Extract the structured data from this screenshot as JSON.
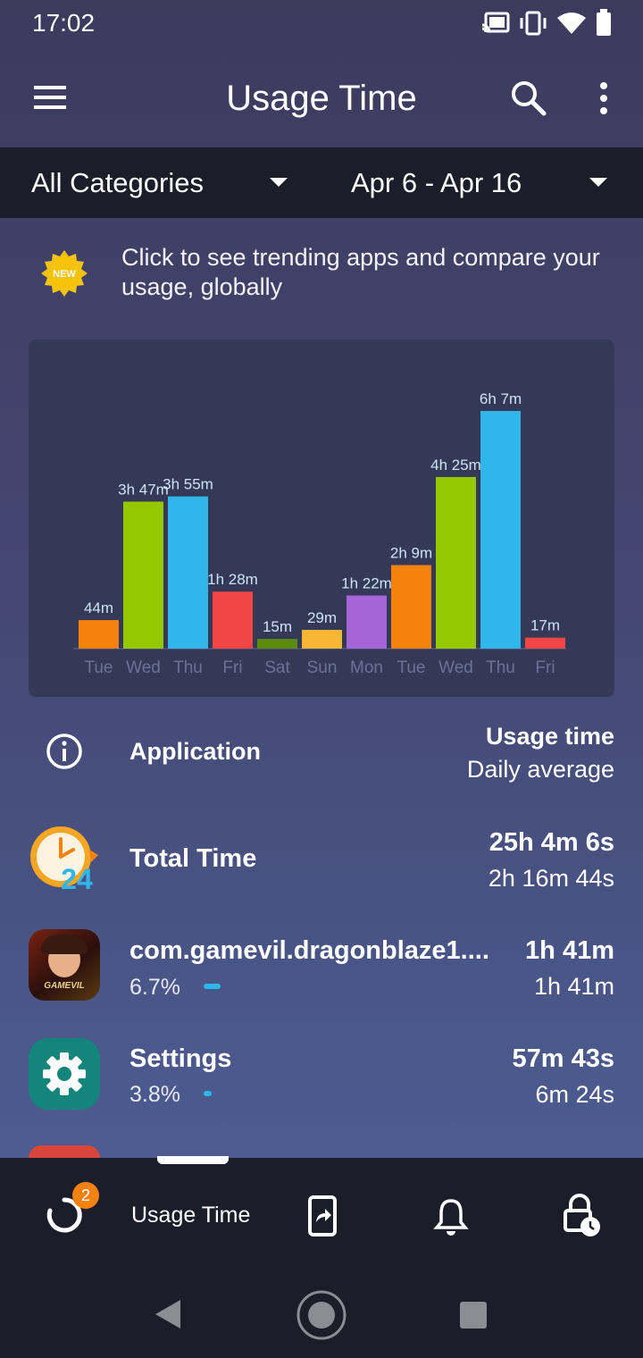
{
  "status": {
    "time": "17:02"
  },
  "header": {
    "title": "Usage Time"
  },
  "filters": {
    "category": "All Categories",
    "date_range": "Apr 6 - Apr 16"
  },
  "promo": {
    "badge": "NEW",
    "text": "Click to see trending apps and compare your usage, globally"
  },
  "chart_data": {
    "type": "bar",
    "categories": [
      "Tue",
      "Wed",
      "Thu",
      "Fri",
      "Sat",
      "Sun",
      "Mon",
      "Tue",
      "Wed",
      "Thu",
      "Fri"
    ],
    "values_minutes": [
      44,
      227,
      235,
      88,
      15,
      29,
      82,
      129,
      265,
      367,
      17
    ],
    "labels": [
      "44m",
      "3h 47m",
      "3h 55m",
      "1h 28m",
      "15m",
      "29m",
      "1h 22m",
      "2h 9m",
      "4h 25m",
      "6h 7m",
      "17m"
    ],
    "colors": [
      "#f5820d",
      "#96c800",
      "#30b6e8",
      "#f24545",
      "#5c8a0c",
      "#f8b634",
      "#a565d6",
      "#f5820d",
      "#96c800",
      "#30b6e8",
      "#f24545"
    ],
    "ylim": [
      0,
      367
    ]
  },
  "list_header": {
    "application": "Application",
    "usage_time": "Usage time",
    "daily_average": "Daily average"
  },
  "rows": [
    {
      "name": "Total Time",
      "total": "25h 4m 6s",
      "avg": "2h 16m 44s"
    },
    {
      "name": "com.gamevil.dragonblaze1....",
      "percent": "6.7%",
      "share": 0.067,
      "total": "1h 41m",
      "avg": "1h 41m",
      "icon_text": "GAMEVIL"
    },
    {
      "name": "Settings",
      "percent": "3.8%",
      "share": 0.038,
      "total": "57m 43s",
      "avg": "6m 24s"
    }
  ],
  "bottom_nav": {
    "badge": "2",
    "active_label": "Usage Time"
  },
  "colors": {
    "accent_blue": "#30b6e8",
    "badge_orange": "#f5820d",
    "nav_bg": "#1b1d28"
  }
}
